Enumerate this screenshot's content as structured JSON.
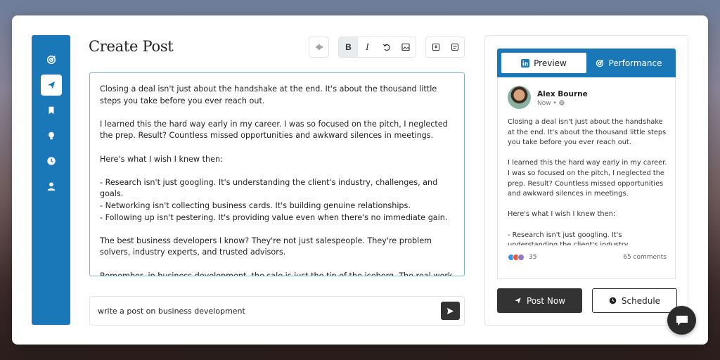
{
  "title": "Create Post",
  "sidebar": {
    "items": [
      {
        "icon": "target-icon",
        "active": false
      },
      {
        "icon": "send-icon",
        "active": true
      },
      {
        "icon": "bookmark-icon",
        "active": false
      },
      {
        "icon": "lightbulb-icon",
        "active": false
      },
      {
        "icon": "clock-icon",
        "active": false
      },
      {
        "icon": "user-icon",
        "active": false
      }
    ]
  },
  "toolbar": {
    "bold_label": "B",
    "italic_label": "I"
  },
  "editor": {
    "paragraphs": [
      "Closing a deal isn't just about the handshake at the end. It's about the thousand little steps you take before you ever reach out.",
      "I learned this the hard way early in my career. I was so focused on the pitch, I neglected the prep. Result? Countless missed opportunities and awkward silences in meetings.",
      "Here's what I wish I knew then:",
      "- Research isn't just googling. It's understanding the client's industry, challenges, and goals.\n- Networking isn't collecting business cards. It's building genuine relationships.\n- Following up isn't pestering. It's providing value even when there's no immediate gain.",
      "The best business developers I know? They're not just salespeople. They're problem solvers, industry experts, and trusted advisors.",
      "Remember, in business development, the sale is just the tip of the iceberg. The real work happens beneath the surface."
    ]
  },
  "prompt": {
    "value": "write a post on business development"
  },
  "preview": {
    "tab_preview": "Preview",
    "tab_performance": "Performance",
    "author_name": "Alex Bourne",
    "author_meta": "Now •",
    "paragraphs": [
      "Closing a deal isn't just about the handshake at the end. It's about the thousand little steps you take before you ever reach out.",
      "I learned this the hard way early in my career. I was so focused on the pitch, I neglected the prep. Result? Countless missed opportunities and awkward silences in meetings.",
      "Here's what I wish I knew then:",
      "- Research isn't just googling. It's understanding the client's industry, challenges, and goals."
    ],
    "reaction_count": "35",
    "comments": "65 comments"
  },
  "actions": {
    "post_now": "Post Now",
    "schedule": "Schedule"
  },
  "colors": {
    "accent": "#1a78b8",
    "dark": "#333333"
  }
}
